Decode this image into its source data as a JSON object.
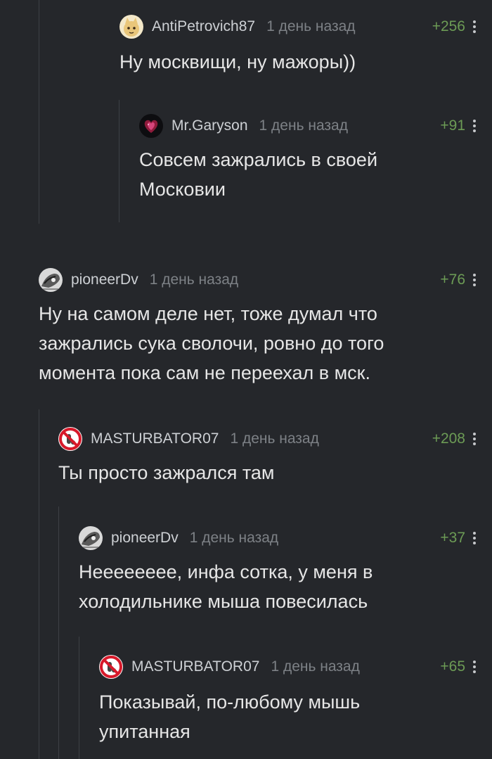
{
  "comments": [
    {
      "username": "AntiPetrovich87",
      "time": "1 день назад",
      "rating": "+256",
      "lines": [
        "Ну москвищи, ну мажоры))"
      ],
      "avatar": "cat-avatar"
    },
    {
      "username": "Mr.Garyson",
      "time": "1 день назад",
      "rating": "+91",
      "lines": [
        "Совсем зажрались в своей",
        "Московии"
      ],
      "avatar": "heart-avatar"
    },
    {
      "username": "pioneerDv",
      "time": "1 день назад",
      "rating": "+76",
      "lines": [
        "Ну на самом деле нет, тоже думал что",
        "зажрались сука сволочи, ровно до того",
        "момента пока сам не переехал в мск."
      ],
      "avatar": "sketch-avatar"
    },
    {
      "username": "MASTURBATOR07",
      "time": "1 день назад",
      "rating": "+208",
      "lines": [
        "Ты просто зажрался там"
      ],
      "avatar": "prohibition-avatar"
    },
    {
      "username": "pioneerDv",
      "time": "1 день назад",
      "rating": "+37",
      "lines": [
        "Неееееееe, инфа сотка, у меня в",
        "холодильнике мыша повесилась"
      ],
      "avatar": "sketch-avatar"
    },
    {
      "username": "MASTURBATOR07",
      "time": "1 день назад",
      "rating": "+65",
      "lines": [
        "Показывай, по-любому мышь",
        "упитанная"
      ],
      "avatar": "prohibition-avatar"
    }
  ],
  "icons": {
    "more": "more-vertical-icon"
  },
  "colors": {
    "background": "#25272b",
    "rating": "#6c9b55",
    "thread_line": "#3d4045"
  }
}
